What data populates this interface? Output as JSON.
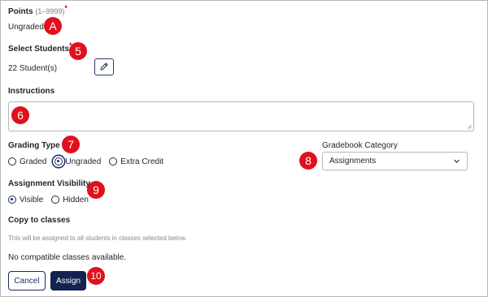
{
  "points": {
    "label": "Points",
    "range_hint": "(1–9999)",
    "required_mark": "*",
    "value": "Ungraded"
  },
  "students": {
    "label": "Select Students",
    "required_mark": "*",
    "value": "22 Student(s)",
    "edit_icon": "pencil-icon"
  },
  "instructions": {
    "label": "Instructions",
    "value": ""
  },
  "grading_type": {
    "label": "Grading Type",
    "options": [
      "Graded",
      "Ungraded",
      "Extra Credit"
    ],
    "selected": "Ungraded"
  },
  "gradebook_category": {
    "label": "Gradebook Category",
    "selected": "Assignments",
    "chevron_icon": "chevron-down-icon"
  },
  "visibility": {
    "label": "Assignment Visibility",
    "options": [
      "Visible",
      "Hidden"
    ],
    "selected": "Visible"
  },
  "copy_to_classes": {
    "label": "Copy to classes",
    "note": "This will be assigned to all students in classes selected below.",
    "empty_message": "No compatible classes available."
  },
  "actions": {
    "cancel_label": "Cancel",
    "assign_label": "Assign"
  },
  "callouts": {
    "points": "A",
    "students": "5",
    "instructions": "6",
    "grading_type": "7",
    "gradebook_category": "8",
    "visibility": "9",
    "assign": "10"
  },
  "colors": {
    "callout": "#e0101c",
    "primary": "#13224f",
    "required": "#d0021b"
  }
}
